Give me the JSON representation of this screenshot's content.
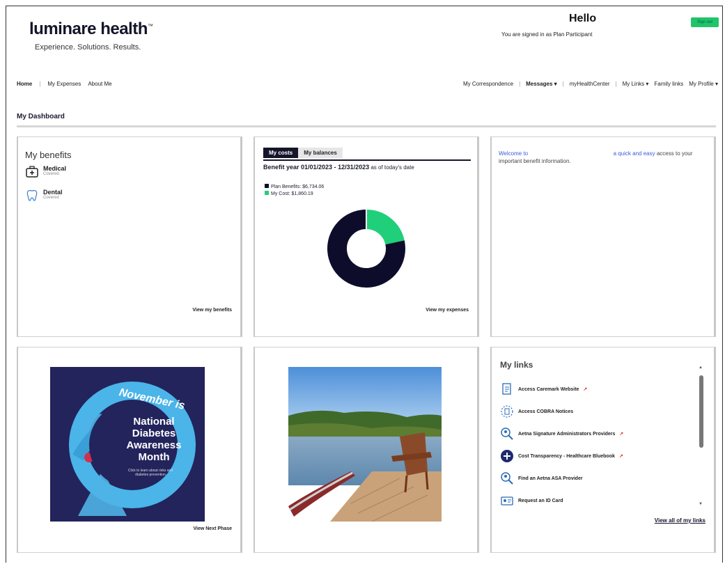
{
  "header": {
    "logo": "luminare health",
    "tagline": "Experience. Solutions. Results.",
    "greeting": "Hello",
    "signed_in": "You are signed in as Plan Participant",
    "sign_out": "Sign out"
  },
  "nav": {
    "left": [
      "Home",
      "My Expenses",
      "About Me"
    ],
    "right": [
      "My Correspondence",
      "Messages ▾",
      "myHealthCenter",
      "My Links ▾",
      "Family links",
      "My Profile ▾"
    ]
  },
  "dashboard_title": "My Dashboard",
  "benefits": {
    "title": "My benefits",
    "items": [
      {
        "name": "Medical",
        "status": "Covered"
      },
      {
        "name": "Dental",
        "status": "Covered"
      }
    ],
    "link": "View my benefits"
  },
  "costs": {
    "tabs": [
      "My costs",
      "My balances"
    ],
    "benefit_year_label": "Benefit year 01/01/2023 - 12/31/2023",
    "benefit_year_suffix": "as of today's date",
    "legend": [
      {
        "label": "Plan Benefits: $6,734.06",
        "color": "#0d0d2b",
        "value": 6734.06
      },
      {
        "label": "My Cost: $1,860.19",
        "color": "#1fcf7a",
        "value": 1860.19
      }
    ],
    "link": "View my expenses"
  },
  "welcome": {
    "text_a": "Welcome to",
    "text_link": "a quick and easy",
    "text_b": "access to your important benefit information."
  },
  "promo": {
    "line1": "November is",
    "line2": "National",
    "line3": "Diabetes",
    "line4": "Awareness",
    "line5": "Month",
    "small": "Click to learn about risks and diabetes prevention",
    "link": "View Next Phase"
  },
  "links": {
    "title": "My links",
    "items": [
      {
        "label": "Access Caremark Website",
        "icon": "clipboard-icon",
        "ext": true
      },
      {
        "label": "Access COBRA Notices",
        "icon": "document-icon",
        "ext": false
      },
      {
        "label": "Aetna Signature Administrators Providers",
        "icon": "search-person-icon",
        "ext": true
      },
      {
        "label": "Cost Transparency - Healthcare Bluebook",
        "icon": "plus-circle-icon",
        "ext": true
      },
      {
        "label": "Find an Aetna ASA Provider",
        "icon": "search-person-icon",
        "ext": false
      },
      {
        "label": "Request an ID Card",
        "icon": "id-card-icon",
        "ext": false
      }
    ],
    "view_all": "View all of my links"
  }
}
